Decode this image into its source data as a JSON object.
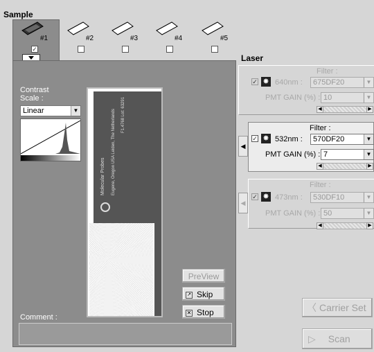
{
  "sample": {
    "title": "Sample",
    "slides": [
      {
        "label": "#1",
        "checked": true
      },
      {
        "label": "#2",
        "checked": false
      },
      {
        "label": "#3",
        "checked": false
      },
      {
        "label": "#4",
        "checked": false
      },
      {
        "label": "#5",
        "checked": false
      }
    ],
    "contrast_label_1": "Contrast",
    "contrast_label_2": "Scale :",
    "contrast_value": "Linear",
    "comment_label": "Comment :",
    "comment_value": "",
    "preview_label": "PreView",
    "skip_label": "Skip",
    "stop_label": "Stop"
  },
  "laser": {
    "title": "Laser",
    "filter_label": "Filter :",
    "gain_label": "PMT GAIN (%) :",
    "channels": [
      {
        "wavelength": "640nm :",
        "filter": "675DF20",
        "gain": "10",
        "active": false
      },
      {
        "wavelength": "532nm :",
        "filter": "570DF20",
        "gain": "7",
        "active": true
      },
      {
        "wavelength": "473nm :",
        "filter": "530DF10",
        "gain": "50",
        "active": false
      }
    ]
  },
  "buttons": {
    "carrier_set": "Carrier Set",
    "scan": "Scan"
  },
  "slide_image": {
    "lot_text": "F1.4768 Lot: 63291",
    "brand_text": "Molecular Probes",
    "address_text": "Eugene, Oregon USA Leiden, The Netherlands"
  },
  "colors": {
    "panel": "#8c8c8c",
    "background": "#d6d6d6"
  }
}
